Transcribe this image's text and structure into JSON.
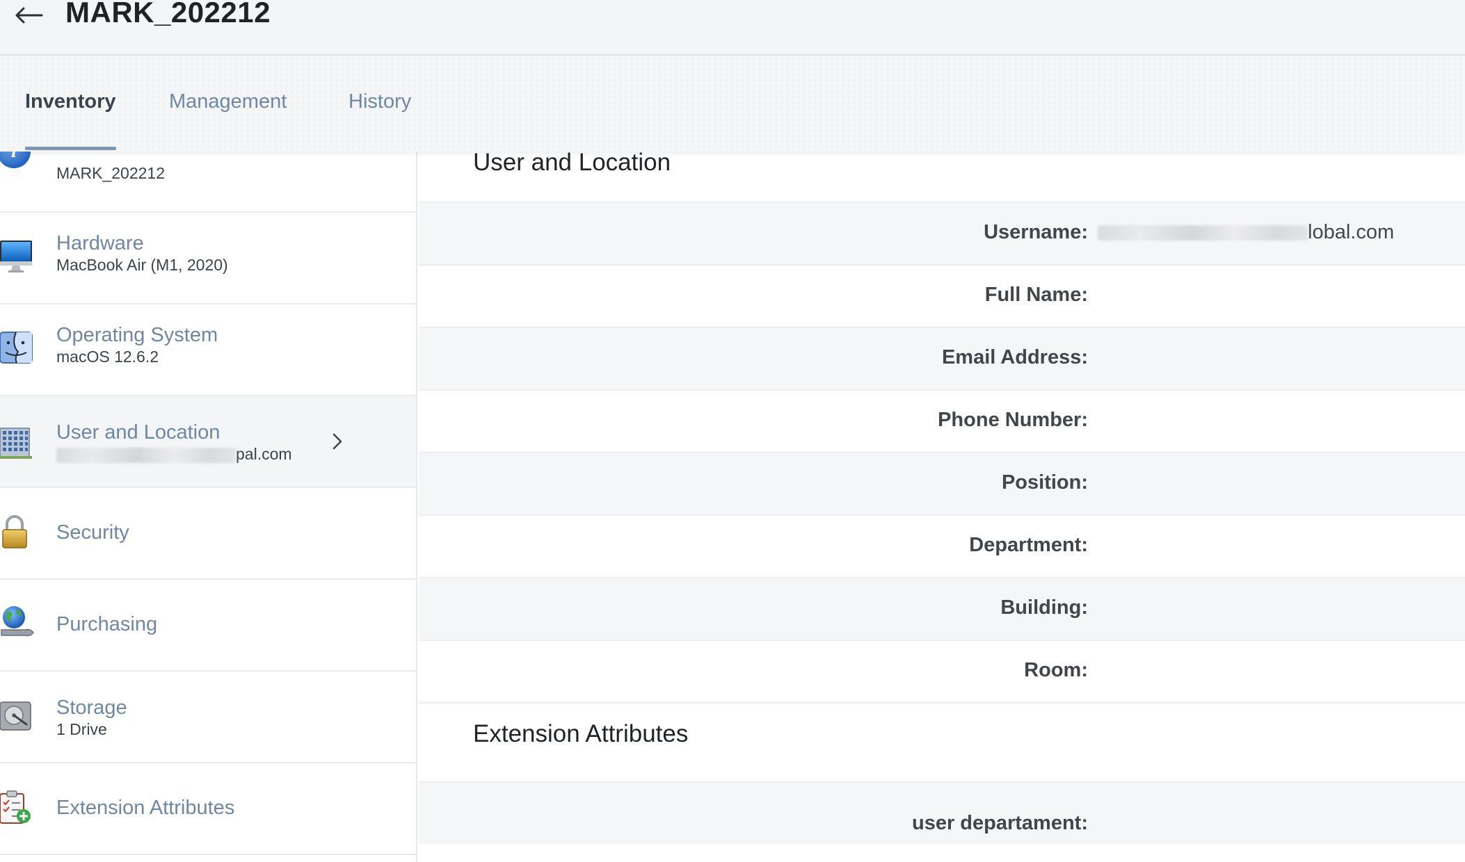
{
  "header": {
    "back_icon": "arrow-left-icon",
    "title": "MARK_202212"
  },
  "tabs": [
    {
      "label": "Inventory",
      "active": true
    },
    {
      "label": "Management",
      "active": false
    },
    {
      "label": "History",
      "active": false
    }
  ],
  "sidebar": {
    "items": [
      {
        "icon": "info-icon",
        "label": "",
        "sub": "MARK_202212"
      },
      {
        "icon": "monitor-icon",
        "label": "Hardware",
        "sub": "MacBook Air (M1, 2020)"
      },
      {
        "icon": "finder-icon",
        "label": "Operating System",
        "sub": "macOS 12.6.2"
      },
      {
        "icon": "building-icon",
        "label": "User and Location",
        "sub": "pal.com",
        "selected": true,
        "chevron_icon": "chevron-right-icon"
      },
      {
        "icon": "lock-icon",
        "label": "Security",
        "sub": ""
      },
      {
        "icon": "globe-wrench-icon",
        "label": "Purchasing",
        "sub": ""
      },
      {
        "icon": "hard-drive-icon",
        "label": "Storage",
        "sub": "1 Drive"
      },
      {
        "icon": "clipboard-add-icon",
        "label": "Extension Attributes",
        "sub": ""
      }
    ]
  },
  "main": {
    "user_location": {
      "title": "User and Location",
      "fields": [
        {
          "label": "Username:",
          "value": "lobal.com"
        },
        {
          "label": "Full Name:",
          "value": ""
        },
        {
          "label": "Email Address:",
          "value": ""
        },
        {
          "label": "Phone Number:",
          "value": ""
        },
        {
          "label": "Position:",
          "value": ""
        },
        {
          "label": "Department:",
          "value": ""
        },
        {
          "label": "Building:",
          "value": ""
        },
        {
          "label": "Room:",
          "value": ""
        }
      ]
    },
    "extension_attributes": {
      "title": "Extension Attributes",
      "fields": [
        {
          "label": "user departament:",
          "value": ""
        }
      ]
    }
  },
  "colors": {
    "accent": "#6e87a6",
    "tab_underline": "#7d96b4",
    "row_alt": "#f5f6f8"
  }
}
